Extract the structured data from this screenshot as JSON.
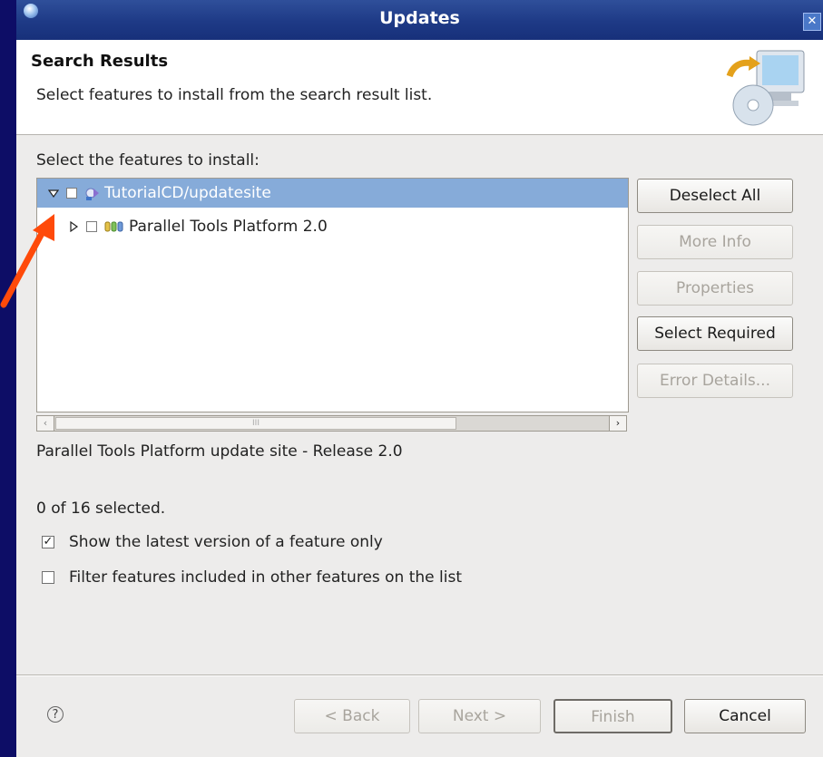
{
  "window": {
    "title": "Updates"
  },
  "banner": {
    "heading": "Search Results",
    "description": "Select features to install from the search result list."
  },
  "tree": {
    "label": "Select the features to install:",
    "rows": [
      {
        "label": "TutorialCD/updatesite",
        "expanded": true,
        "checked": false,
        "selected": true,
        "icon": "update-site-icon"
      },
      {
        "label": "Parallel Tools Platform 2.0",
        "expanded": false,
        "checked": false,
        "selected": false,
        "icon": "feature-icon"
      }
    ],
    "scroll_grip": "III"
  },
  "side_buttons": {
    "deselect_all": "Deselect All",
    "more_info": "More Info",
    "properties": "Properties",
    "select_required": "Select Required",
    "error_details": "Error Details..."
  },
  "site_description": "Parallel Tools Platform update site - Release 2.0",
  "selection_count": "0 of 16 selected.",
  "options": {
    "latest_version": {
      "label": "Show the latest version of a feature only",
      "checked": true
    },
    "filter_included": {
      "label": "Filter features included in other features on the list",
      "checked": false
    }
  },
  "footer": {
    "back": "< Back",
    "next": "Next >",
    "finish": "Finish",
    "cancel": "Cancel"
  },
  "colors": {
    "title_bar": "#1e3a86",
    "selection": "#86abd9",
    "callout_arrow": "#ff4a0a",
    "desktop": "#0d0d66"
  }
}
